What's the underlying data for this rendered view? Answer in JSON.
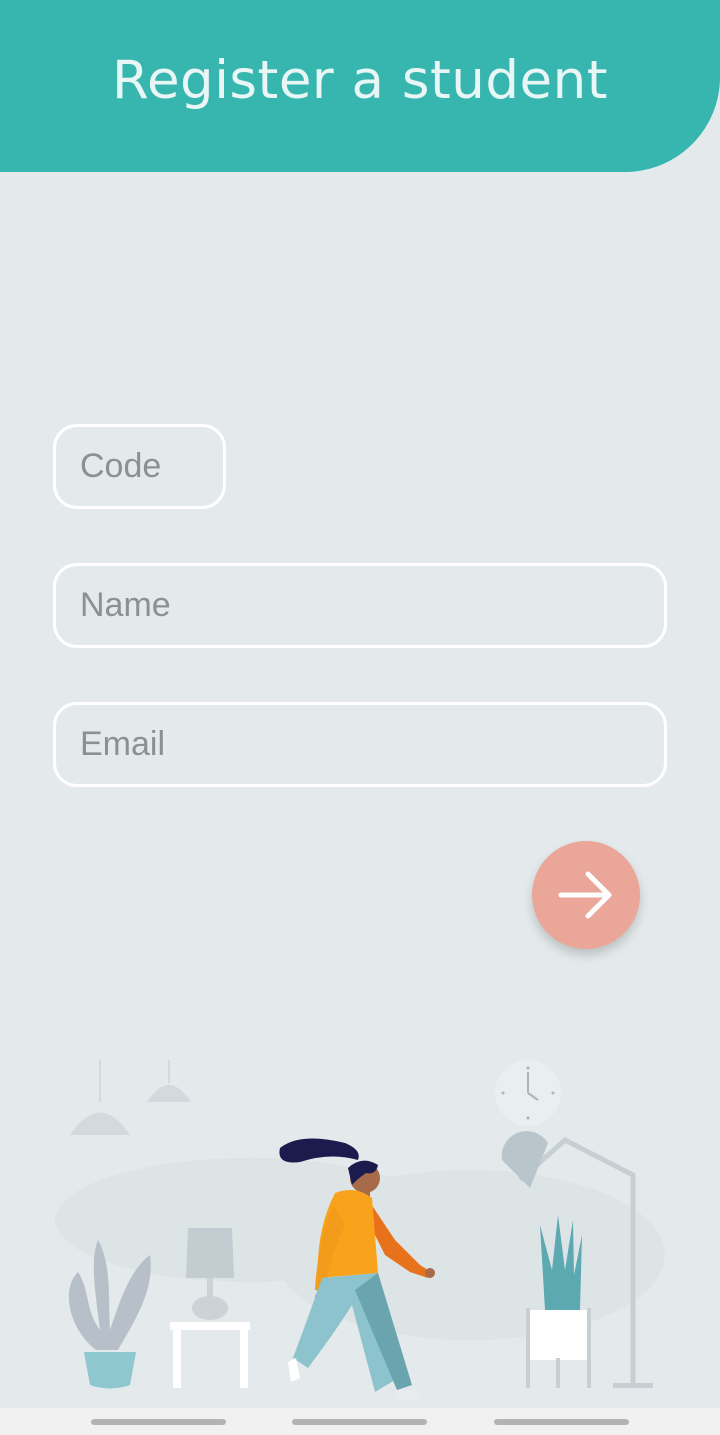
{
  "header": {
    "title": "Register a student"
  },
  "form": {
    "code": {
      "placeholder": "Code",
      "value": ""
    },
    "name": {
      "placeholder": "Name",
      "value": ""
    },
    "email": {
      "placeholder": "Email",
      "value": ""
    }
  },
  "submit": {
    "icon": "arrow-right-icon"
  },
  "colors": {
    "header": "#37b5af",
    "background": "#e4eaeb",
    "fab": "#eba69a"
  }
}
